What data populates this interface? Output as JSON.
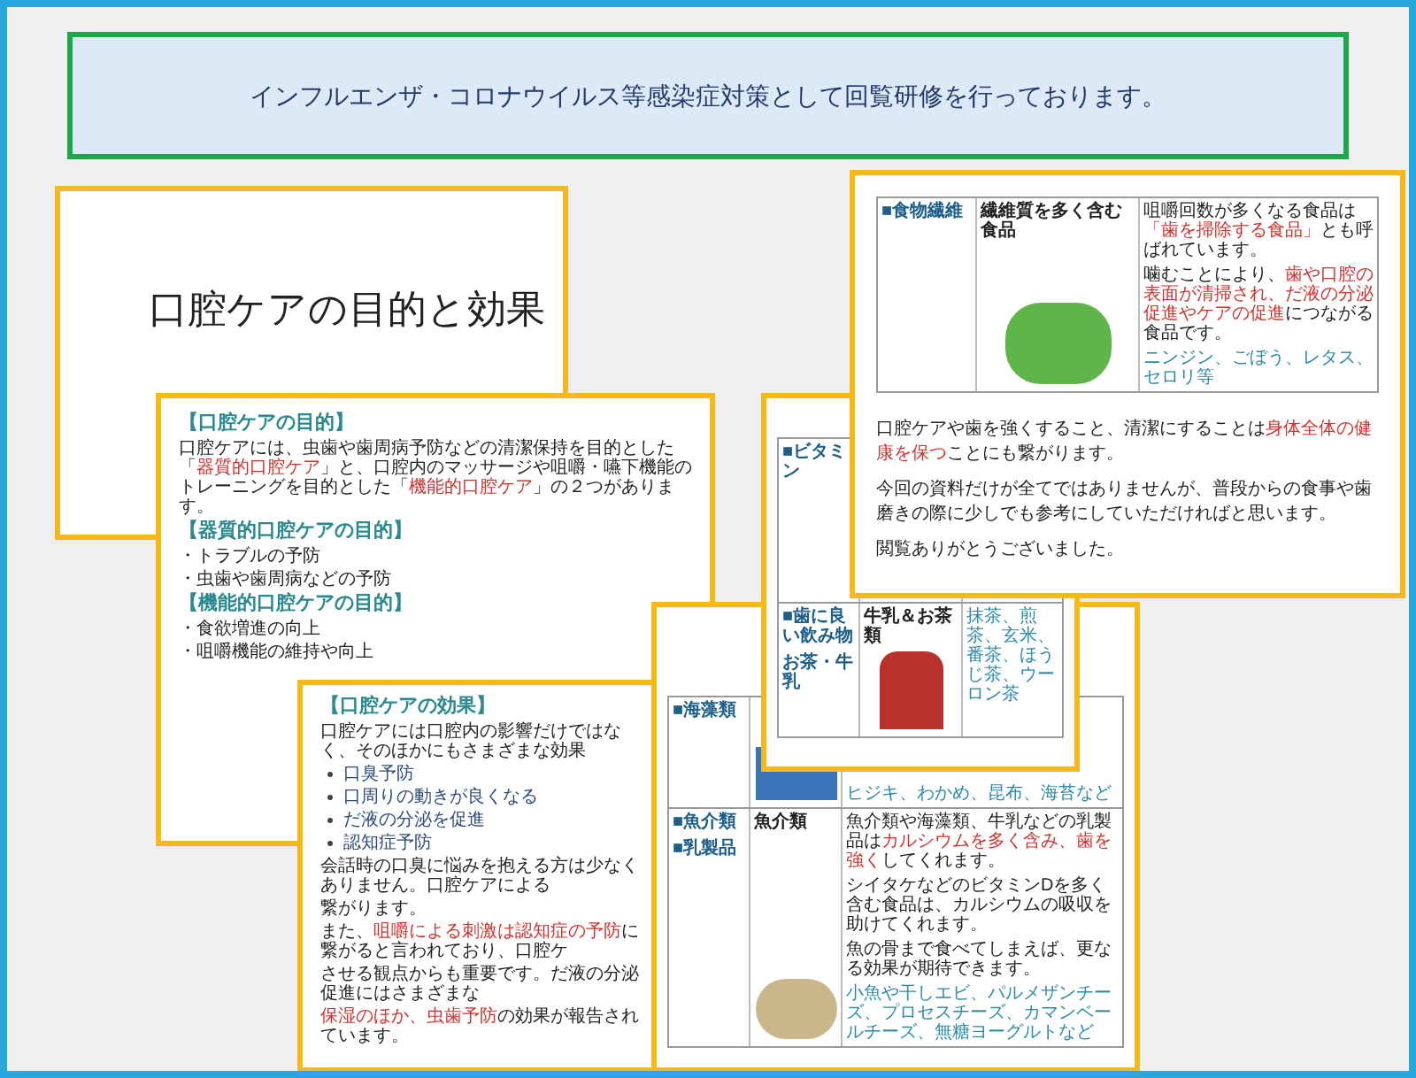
{
  "banner": {
    "text": "インフルエンザ・コロナウイルス等感染症対策として回覧研修を行っております。"
  },
  "slides": [
    {
      "kind": "title",
      "title": "口腔ケアの目的と効果"
    },
    {
      "kind": "content",
      "blocks": [
        {
          "kind": "heading",
          "text": "【口腔ケアの目的】"
        },
        {
          "kind": "text",
          "segments": [
            {
              "text": "口腔ケアには、虫歯や歯周病予防などの清潔保持を目的とした「",
              "highlight": false
            },
            {
              "text": "器質的口腔ケア",
              "highlight": true
            },
            {
              "text": "」と、口腔内のマッサージや咀嚼・嚥下機能のトレーニングを目的とした「",
              "highlight": false
            },
            {
              "text": "機能的口腔ケア",
              "highlight": true
            },
            {
              "text": "」の２つがあります。",
              "highlight": false
            }
          ]
        },
        {
          "kind": "heading",
          "text": "【器質的口腔ケアの目的】"
        },
        {
          "kind": "text",
          "segments": [
            {
              "text": "・トラブルの予防",
              "highlight": false
            }
          ]
        },
        {
          "kind": "text",
          "segments": [
            {
              "text": "・虫歯や歯周病などの予防",
              "highlight": false
            }
          ]
        },
        {
          "kind": "heading",
          "text": "【機能的口腔ケアの目的】"
        },
        {
          "kind": "text",
          "segments": [
            {
              "text": "・食欲増進の向上",
              "highlight": false
            }
          ]
        },
        {
          "kind": "text",
          "segments": [
            {
              "text": "・咀嚼機能の維持や向上",
              "highlight": false
            }
          ]
        }
      ]
    },
    {
      "kind": "content",
      "blocks": [
        {
          "kind": "heading",
          "text": "【口腔ケアの効果】"
        },
        {
          "kind": "text",
          "segments": [
            {
              "text": "口腔ケアには口腔内の影響だけではなく、そのほかにもさまざまな効果",
              "highlight": false
            }
          ]
        },
        {
          "kind": "bullet",
          "text": "口臭予防"
        },
        {
          "kind": "bullet",
          "text": "口周りの動きが良くなる"
        },
        {
          "kind": "bullet",
          "text": "だ液の分泌を促進"
        },
        {
          "kind": "bullet",
          "text": "認知症予防"
        },
        {
          "kind": "text",
          "segments": [
            {
              "text": "会話時の口臭に悩みを抱える方は少なくありません。口腔ケアによる",
              "highlight": false
            }
          ]
        },
        {
          "kind": "text",
          "segments": [
            {
              "text": "繋がります。",
              "highlight": false
            }
          ]
        },
        {
          "kind": "text",
          "segments": [
            {
              "text": "また、",
              "highlight": false
            },
            {
              "text": "咀嚼による刺激は認知症の予防",
              "highlight": true
            },
            {
              "text": "に繋がると言われており、口腔ケ",
              "highlight": false
            }
          ]
        },
        {
          "kind": "text",
          "segments": [
            {
              "text": "させる観点からも重要です。だ液の分泌促進にはさまざまな",
              "highlight": false
            }
          ]
        },
        {
          "kind": "text",
          "segments": [
            {
              "text": "保湿のほか、",
              "highlight": true
            },
            {
              "text": "虫歯予防",
              "highlight": true
            },
            {
              "text": "の効果が報告されています。",
              "highlight": false
            }
          ]
        }
      ]
    },
    {
      "kind": "content",
      "blocks": [
        {
          "kind": "table",
          "rows": [
            {
              "labels": [
                "■ビタミン"
              ],
              "details": []
            },
            {
              "labels": [
                "■歯に良い飲み物",
                "お茶・牛乳"
              ],
              "caption": "牛乳＆お茶類",
              "photo": true,
              "details": [
                {
                  "kind": "examples",
                  "text": "抹茶、煎茶、玄米、番茶、ほうじ茶、ウーロン茶"
                }
              ]
            }
          ]
        }
      ]
    },
    {
      "kind": "content",
      "blocks": [
        {
          "kind": "table",
          "rows": [
            {
              "labels": [
                "■海藻類"
              ],
              "photo": true,
              "details": [
                {
                  "kind": "examples",
                  "text": "ヒジキ、わかめ、昆布、海苔など"
                }
              ]
            },
            {
              "labels": [
                "■魚介類",
                "■乳製品"
              ],
              "caption": "魚介類",
              "photo": true,
              "details": [
                {
                  "kind": "text",
                  "segments": [
                    {
                      "text": "魚介類や海藻類、牛乳などの乳製品は",
                      "highlight": false
                    },
                    {
                      "text": "カルシウムを多く含み、歯を強く",
                      "highlight": true
                    },
                    {
                      "text": "してくれます。",
                      "highlight": false
                    }
                  ]
                },
                {
                  "kind": "text",
                  "segments": [
                    {
                      "text": "シイタケなどのビタミンDを多く含む食品は、カルシウムの吸収を助けてくれます。",
                      "highlight": false
                    }
                  ]
                },
                {
                  "kind": "text",
                  "segments": [
                    {
                      "text": "魚の骨まで食べてしまえば、更なる効果が期待できます。",
                      "highlight": false
                    }
                  ]
                },
                {
                  "kind": "examples",
                  "text": "小魚や干しエビ、パルメザンチーズ、プロセスチーズ、カマンベールチーズ、無糖ヨーグルトなど"
                }
              ]
            }
          ]
        }
      ]
    },
    {
      "kind": "content",
      "blocks": [
        {
          "kind": "table",
          "rows": [
            {
              "labels": [
                "■食物繊維"
              ],
              "caption": "繊維質を多く含む食品",
              "photo": true,
              "details": [
                {
                  "kind": "text",
                  "segments": [
                    {
                      "text": "咀嚼回数が多くなる食品は",
                      "highlight": false
                    },
                    {
                      "text": "「歯を掃除する食品」",
                      "highlight": true
                    },
                    {
                      "text": "とも呼ばれています。",
                      "highlight": false
                    }
                  ]
                },
                {
                  "kind": "text",
                  "segments": [
                    {
                      "text": "噛むことにより、",
                      "highlight": false
                    },
                    {
                      "text": "歯や口腔の表面が清掃され、だ液の分泌促進やケアの促進",
                      "highlight": true
                    },
                    {
                      "text": "につながる食品です。",
                      "highlight": false
                    }
                  ]
                },
                {
                  "kind": "examples",
                  "text": "ニンジン、ごぼう、レタス、セロリ等"
                }
              ]
            }
          ]
        },
        {
          "kind": "text",
          "segments": [
            {
              "text": "口腔ケアや歯を強くすること、清潔にすることは",
              "highlight": false
            },
            {
              "text": "身体全体の健康を保つ",
              "highlight": true
            },
            {
              "text": "ことにも繋がります。",
              "highlight": false
            }
          ]
        },
        {
          "kind": "text",
          "segments": [
            {
              "text": "今回の資料だけが全てではありませんが、普段からの食事や歯磨きの際に少しでも参考にしていただければと思います。",
              "highlight": false
            }
          ]
        },
        {
          "kind": "text",
          "segments": [
            {
              "text": "閲覧ありがとうございました。",
              "highlight": false
            }
          ]
        }
      ]
    }
  ]
}
